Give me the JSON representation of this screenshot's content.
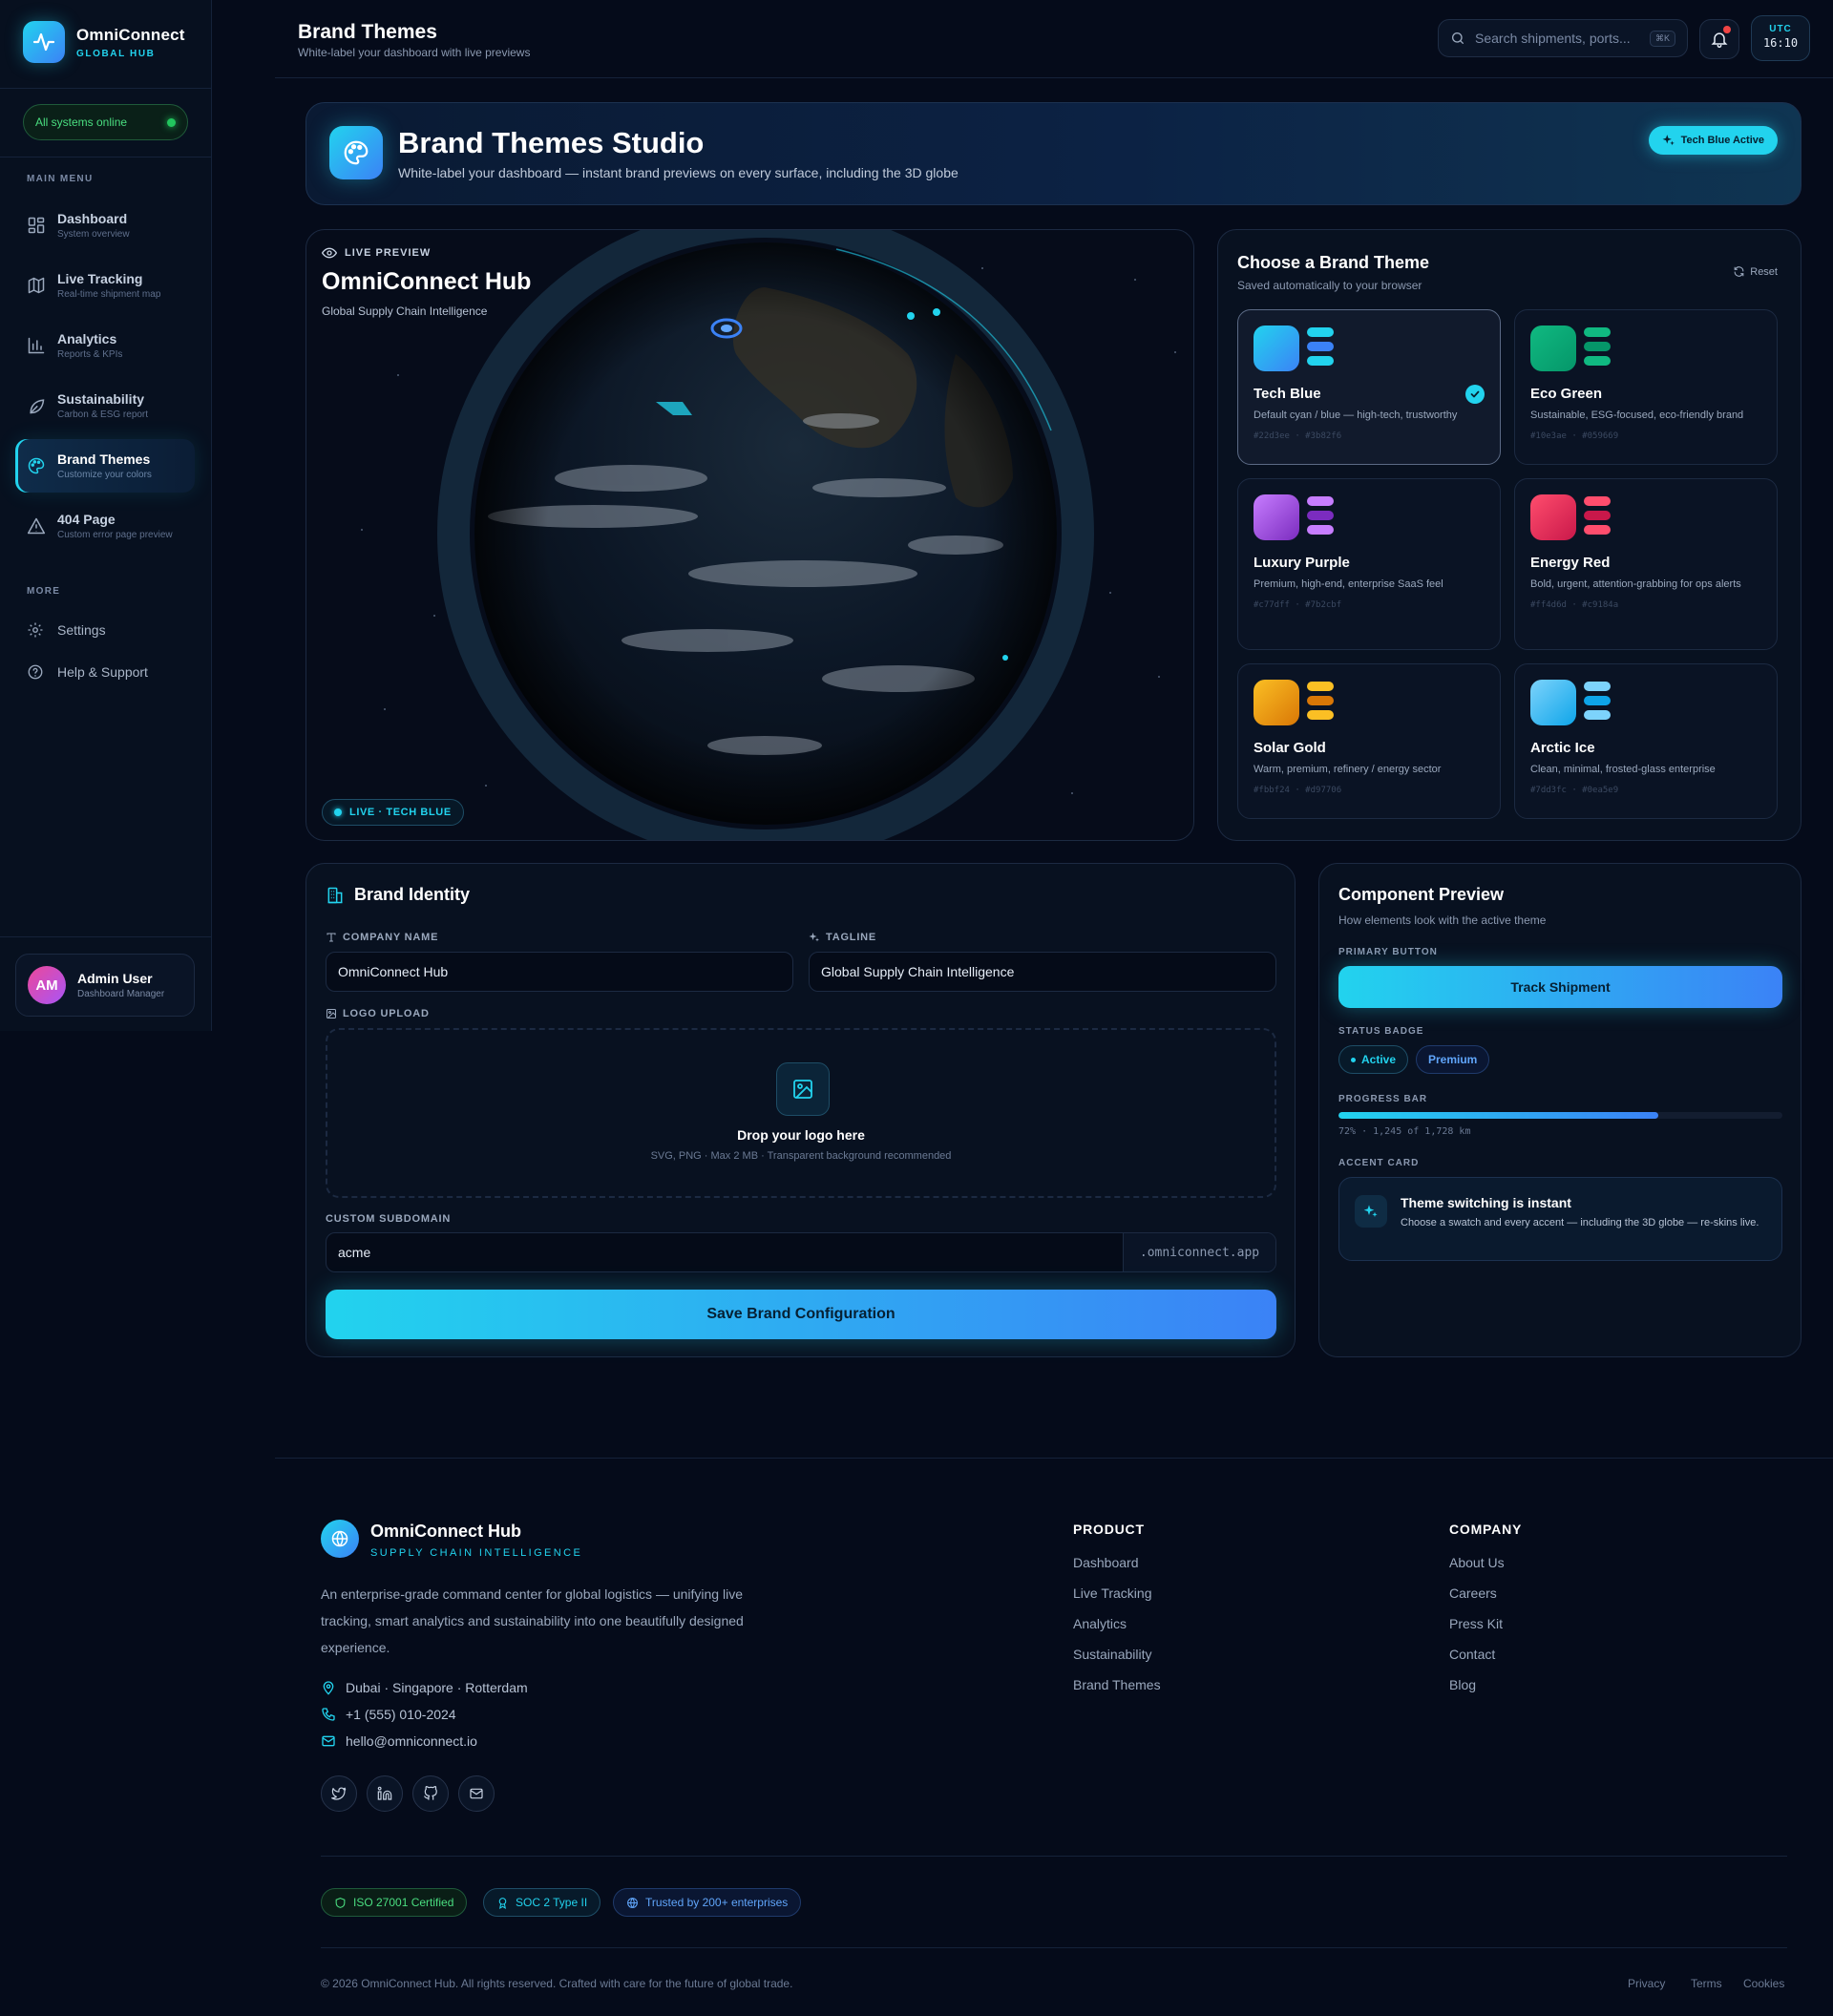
{
  "app": {
    "name": "OmniConnect",
    "subtitle": "GLOBAL HUB"
  },
  "sidebar": {
    "status": "All systems online",
    "main_menu_title": "MAIN MENU",
    "items": [
      {
        "label": "Dashboard",
        "sub": "System overview",
        "icon": "grid-icon"
      },
      {
        "label": "Live Tracking",
        "sub": "Real-time shipment map",
        "icon": "map-icon"
      },
      {
        "label": "Analytics",
        "sub": "Reports & KPIs",
        "icon": "bar-chart-icon"
      },
      {
        "label": "Sustainability",
        "sub": "Carbon & ESG report",
        "icon": "leaf-icon"
      },
      {
        "label": "Brand Themes",
        "sub": "Customize your colors",
        "icon": "palette-icon",
        "active": true
      },
      {
        "label": "404 Page",
        "sub": "Custom error page preview",
        "icon": "warning-icon"
      }
    ],
    "more_title": "MORE",
    "more": [
      {
        "label": "Settings",
        "icon": "gear-icon"
      },
      {
        "label": "Help & Support",
        "icon": "help-icon"
      }
    ],
    "user": {
      "initials": "AM",
      "name": "Admin User",
      "role": "Dashboard Manager"
    }
  },
  "header": {
    "title": "Brand Themes",
    "subtitle": "White-label your dashboard with live previews",
    "search_placeholder": "Search shipments, ports...",
    "search_shortcut": "⌘K",
    "utc_label": "UTC",
    "utc_time": "16:10"
  },
  "hero": {
    "title": "Brand Themes Studio",
    "subtitle": "White-label your dashboard — instant brand previews on every surface, including the 3D globe",
    "badge": "Tech Blue Active"
  },
  "preview": {
    "label": "LIVE PREVIEW",
    "title": "OmniConnect Hub",
    "subtitle": "Global Supply Chain Intelligence",
    "badge": "LIVE · TECH BLUE"
  },
  "themes": {
    "title": "Choose a Brand Theme",
    "subtitle": "Saved automatically to your browser",
    "reset": "Reset",
    "items": [
      {
        "name": "Tech Blue",
        "desc": "Default cyan / blue — high-tech, trustworthy",
        "hex": "#22d3ee · #3b82f6",
        "c1": "#22d3ee",
        "c2": "#3b82f6",
        "selected": true
      },
      {
        "name": "Eco Green",
        "desc": "Sustainable, ESG-focused, eco-friendly brand",
        "hex": "#10e3ae · #059669",
        "c1": "#10b981",
        "c2": "#059669",
        "selected": false
      },
      {
        "name": "Luxury Purple",
        "desc": "Premium, high-end, enterprise SaaS feel",
        "hex": "#c77dff · #7b2cbf",
        "c1": "#c77dff",
        "c2": "#7b2cbf",
        "selected": false
      },
      {
        "name": "Energy Red",
        "desc": "Bold, urgent, attention-grabbing for ops alerts",
        "hex": "#ff4d6d · #c9184a",
        "c1": "#ff4d6d",
        "c2": "#c9184a",
        "selected": false
      },
      {
        "name": "Solar Gold",
        "desc": "Warm, premium, refinery / energy sector",
        "hex": "#fbbf24 · #d97706",
        "c1": "#fbbf24",
        "c2": "#d97706",
        "selected": false
      },
      {
        "name": "Arctic Ice",
        "desc": "Clean, minimal, frosted-glass enterprise",
        "hex": "#7dd3fc · #0ea5e9",
        "c1": "#7dd3fc",
        "c2": "#0ea5e9",
        "selected": false
      }
    ]
  },
  "identity": {
    "title": "Brand Identity",
    "company_label": "COMPANY NAME",
    "company_value": "OmniConnect Hub",
    "tagline_label": "TAGLINE",
    "tagline_value": "Global Supply Chain Intelligence",
    "logo_label": "LOGO UPLOAD",
    "drop_title": "Drop your logo here",
    "drop_sub": "SVG, PNG · Max 2 MB · Transparent background recommended",
    "subdomain_label": "CUSTOM SUBDOMAIN",
    "subdomain_value": "acme",
    "subdomain_suffix": ".omniconnect.app",
    "save": "Save Brand Configuration"
  },
  "component": {
    "title": "Component Preview",
    "subtitle": "How elements look with the active theme",
    "primary_label": "PRIMARY BUTTON",
    "primary_button": "Track Shipment",
    "status_label": "STATUS BADGE",
    "badge_active": "Active",
    "badge_premium": "Premium",
    "progress_label": "PROGRESS BAR",
    "progress_value": 0.72,
    "progress_text": "72% · 1,245 of 1,728 km",
    "accent_label": "ACCENT CARD",
    "accent_title": "Theme switching is instant",
    "accent_text": "Choose a swatch and every accent — including the 3D globe — re-skins live."
  },
  "footer": {
    "brand": "OmniConnect Hub",
    "tagline": "SUPPLY CHAIN INTELLIGENCE",
    "desc": "An enterprise-grade command center for global logistics — unifying live tracking, smart analytics and sustainability into one beautifully designed experience.",
    "location": "Dubai · Singapore · Rotterdam",
    "phone": "+1 (555) 010-2024",
    "email": "hello@omniconnect.io",
    "product_title": "PRODUCT",
    "product_links": [
      "Dashboard",
      "Live Tracking",
      "Analytics",
      "Sustainability",
      "Brand Themes"
    ],
    "company_title": "COMPANY",
    "company_links": [
      "About Us",
      "Careers",
      "Press Kit",
      "Contact",
      "Blog"
    ],
    "certs": [
      "ISO 27001 Certified",
      "SOC 2 Type II",
      "Trusted by 200+ enterprises"
    ],
    "copyright": "© 2026 OmniConnect Hub. All rights reserved. Crafted with care for the future of global trade.",
    "legal": [
      "Privacy",
      "Terms",
      "Cookies"
    ]
  }
}
